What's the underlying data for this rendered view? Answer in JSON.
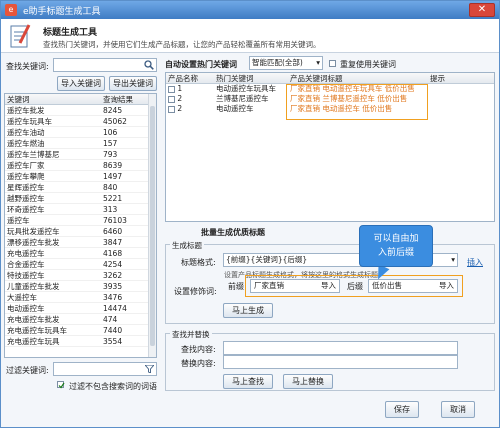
{
  "window": {
    "title": "e助手标题生成工具",
    "close_label": "✕"
  },
  "header": {
    "title": "标题生成工具",
    "description": "查找热门关键词，并使用它们生成产品标题，让您的产品轻松覆盖所有常用关键词。"
  },
  "left": {
    "search_label": "查找关键词:",
    "search_value": "",
    "import_button": "导入关键词",
    "export_button": "导出关键词",
    "columns": [
      "关键词",
      "查询结果"
    ],
    "rows": [
      [
        "遥控车批发",
        "8245"
      ],
      [
        "遥控车玩具车",
        "45062"
      ],
      [
        "遥控车油动",
        "106"
      ],
      [
        "遥控车燃油",
        "157"
      ],
      [
        "遥控车兰博基尼",
        "793"
      ],
      [
        "遥控车厂家",
        "8639"
      ],
      [
        "遥控车攀爬",
        "1497"
      ],
      [
        "星辉遥控车",
        "840"
      ],
      [
        "越野遥控车",
        "5221"
      ],
      [
        "环奇遥控车",
        "313"
      ],
      [
        "遥控车",
        "76103"
      ],
      [
        "玩具批发遥控车",
        "6460"
      ],
      [
        "漂移遥控车批发",
        "3847"
      ],
      [
        "充电遥控车",
        "4168"
      ],
      [
        "合金遥控车",
        "4254"
      ],
      [
        "特技遥控车",
        "3262"
      ],
      [
        "儿童遥控车批发",
        "3935"
      ],
      [
        "大遥控车",
        "3476"
      ],
      [
        "电动遥控车",
        "14474"
      ],
      [
        "充电遥控车批发",
        "474"
      ],
      [
        "充电遥控车玩具车",
        "7440"
      ],
      [
        "充电遥控车玩具",
        "3554"
      ]
    ],
    "filter_label": "过滤关键词:",
    "filter_value": "",
    "filter_checkbox_label": "过滤不包含搜索词的词语"
  },
  "auto": {
    "label": "自动设置热门关键词",
    "select_value": "智能匹配(全部)",
    "repeat_label": "重复使用关键词",
    "columns": [
      "产品名称",
      "热门关键词",
      "产品关键词标题",
      "提示"
    ],
    "rows": [
      {
        "name": "1",
        "keyword": "电动遥控车玩具车",
        "title": "厂家直销 电动遥控车玩具车 低价出售"
      },
      {
        "name": "2",
        "keyword": "兰博基尼遥控车",
        "title": "厂家直销 兰博基尼遥控车 低价出售"
      },
      {
        "name": "2",
        "keyword": "电动遥控车",
        "title": "厂家直销 电动遥控车 低价出售"
      }
    ]
  },
  "batch": {
    "title": "批量生成优质标题",
    "group_label": "生成标题",
    "format_label": "标题格式:",
    "format_value": "{前缀}{关键词}{后缀}",
    "insert_label": "插入",
    "format_hint": "设置产品标题生成格式，将按这里的格式生成标题",
    "modifier_label": "设置修饰词:",
    "prefix_label": "前缀",
    "prefix_value": "厂家直销",
    "prefix_import": "导入",
    "suffix_label": "后缀",
    "suffix_value": "低价出售",
    "suffix_import": "导入",
    "generate_button": "马上生成"
  },
  "replace": {
    "group_label": "查找并替换",
    "find_label": "查找内容:",
    "find_value": "",
    "replace_label": "替换内容:",
    "replace_value": "",
    "find_button": "马上查找",
    "replace_button": "马上替换"
  },
  "callout": {
    "text": "可以自由加入前后缀"
  },
  "footer": {
    "save_button": "保存",
    "cancel_button": "取消"
  },
  "colors": {
    "accent": "#3f7cc4",
    "highlight": "#f0a020",
    "title_text": "#e0761b"
  }
}
